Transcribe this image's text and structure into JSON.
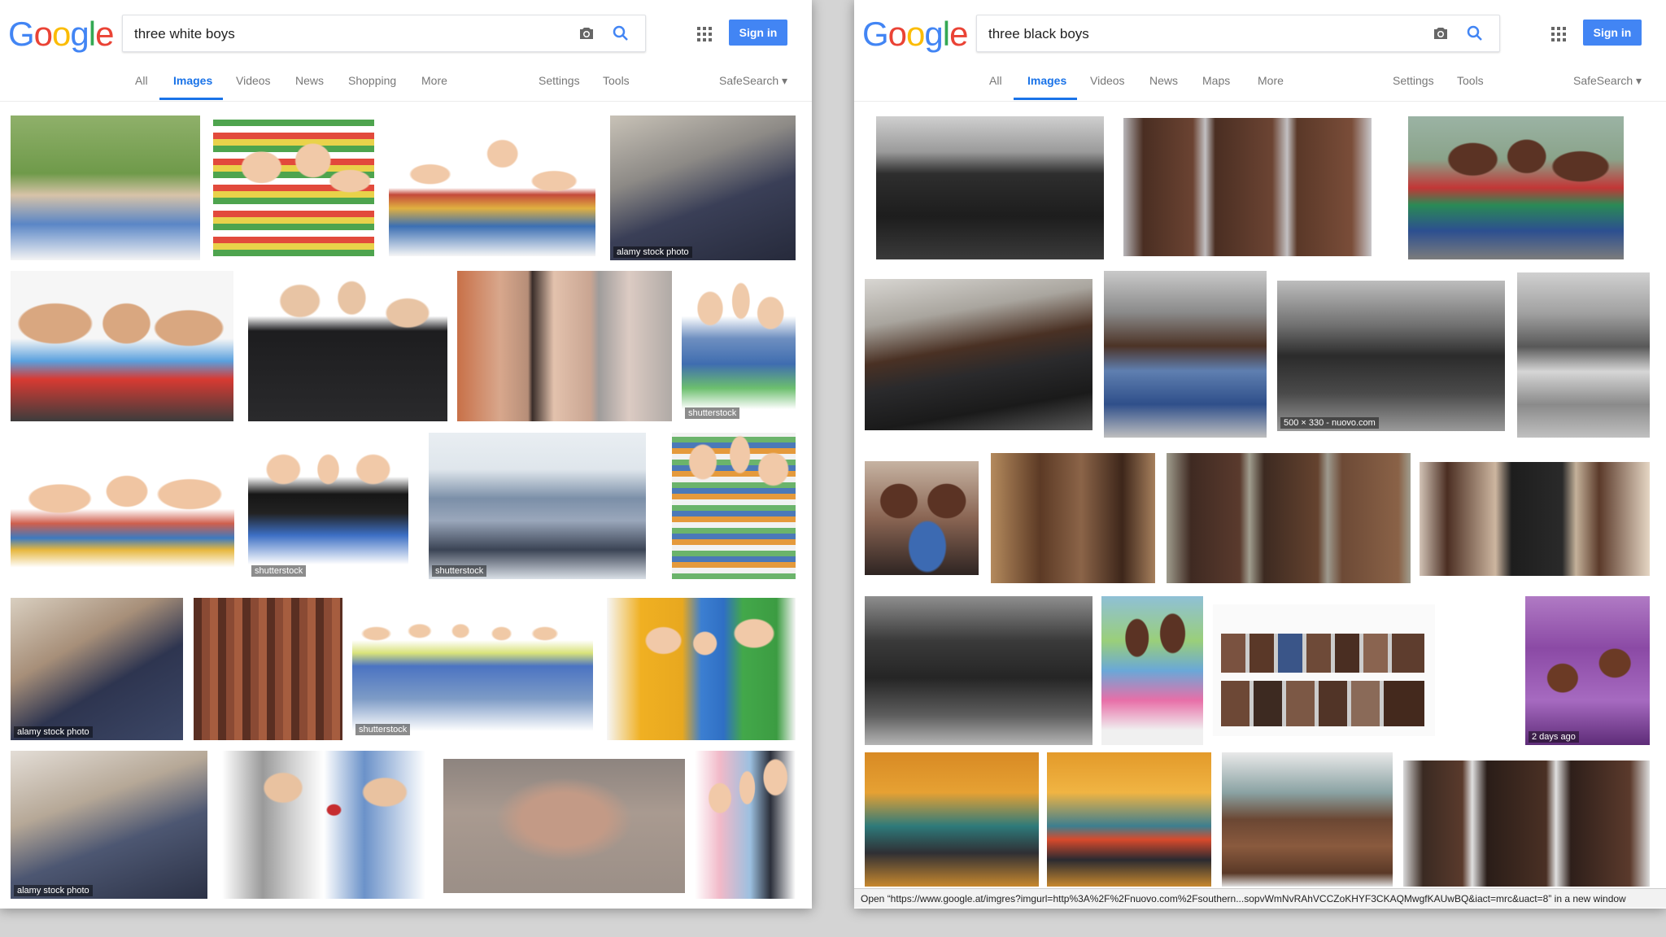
{
  "left": {
    "logo": [
      "G",
      "o",
      "o",
      "g",
      "l",
      "e"
    ],
    "query": "three white boys",
    "signin": "Sign in",
    "tabs": [
      "All",
      "Images",
      "Videos",
      "News",
      "Shopping",
      "More"
    ],
    "settings": "Settings",
    "tools": "Tools",
    "safesearch": "SafeSearch ▾",
    "captions": {
      "c1": "alamy stock photo",
      "c2": "shutterstock",
      "c3": "shutterstock",
      "c4": "shutterstock",
      "c5": "alamy stock photo",
      "c6": "shutterstock",
      "c7": "alamy stock photo"
    }
  },
  "right": {
    "logo": [
      "G",
      "o",
      "o",
      "g",
      "l",
      "e"
    ],
    "query": "three black boys",
    "signin": "Sign in",
    "tabs": [
      "All",
      "Images",
      "Videos",
      "News",
      "Maps",
      "More"
    ],
    "settings": "Settings",
    "tools": "Tools",
    "safesearch": "SafeSearch ▾",
    "captions": {
      "c1": "500 × 330 - nuovo.com",
      "c2": "2 days ago"
    }
  },
  "statusbar": "Open “https://www.google.at/imgres?imgurl=http%3A%2F%2Fnuovo.com%2Fsouthern...sopvWmNvRAhVCCZoKHYF3CKAQMwgfKAUwBQ&iact=mrc&uact=8” in a new window",
  "colors": {
    "google_blue": "#4285f4",
    "google_red": "#ea4335",
    "google_yellow": "#fbbc05",
    "google_green": "#34a853",
    "active_tab": "#1a73e8"
  }
}
